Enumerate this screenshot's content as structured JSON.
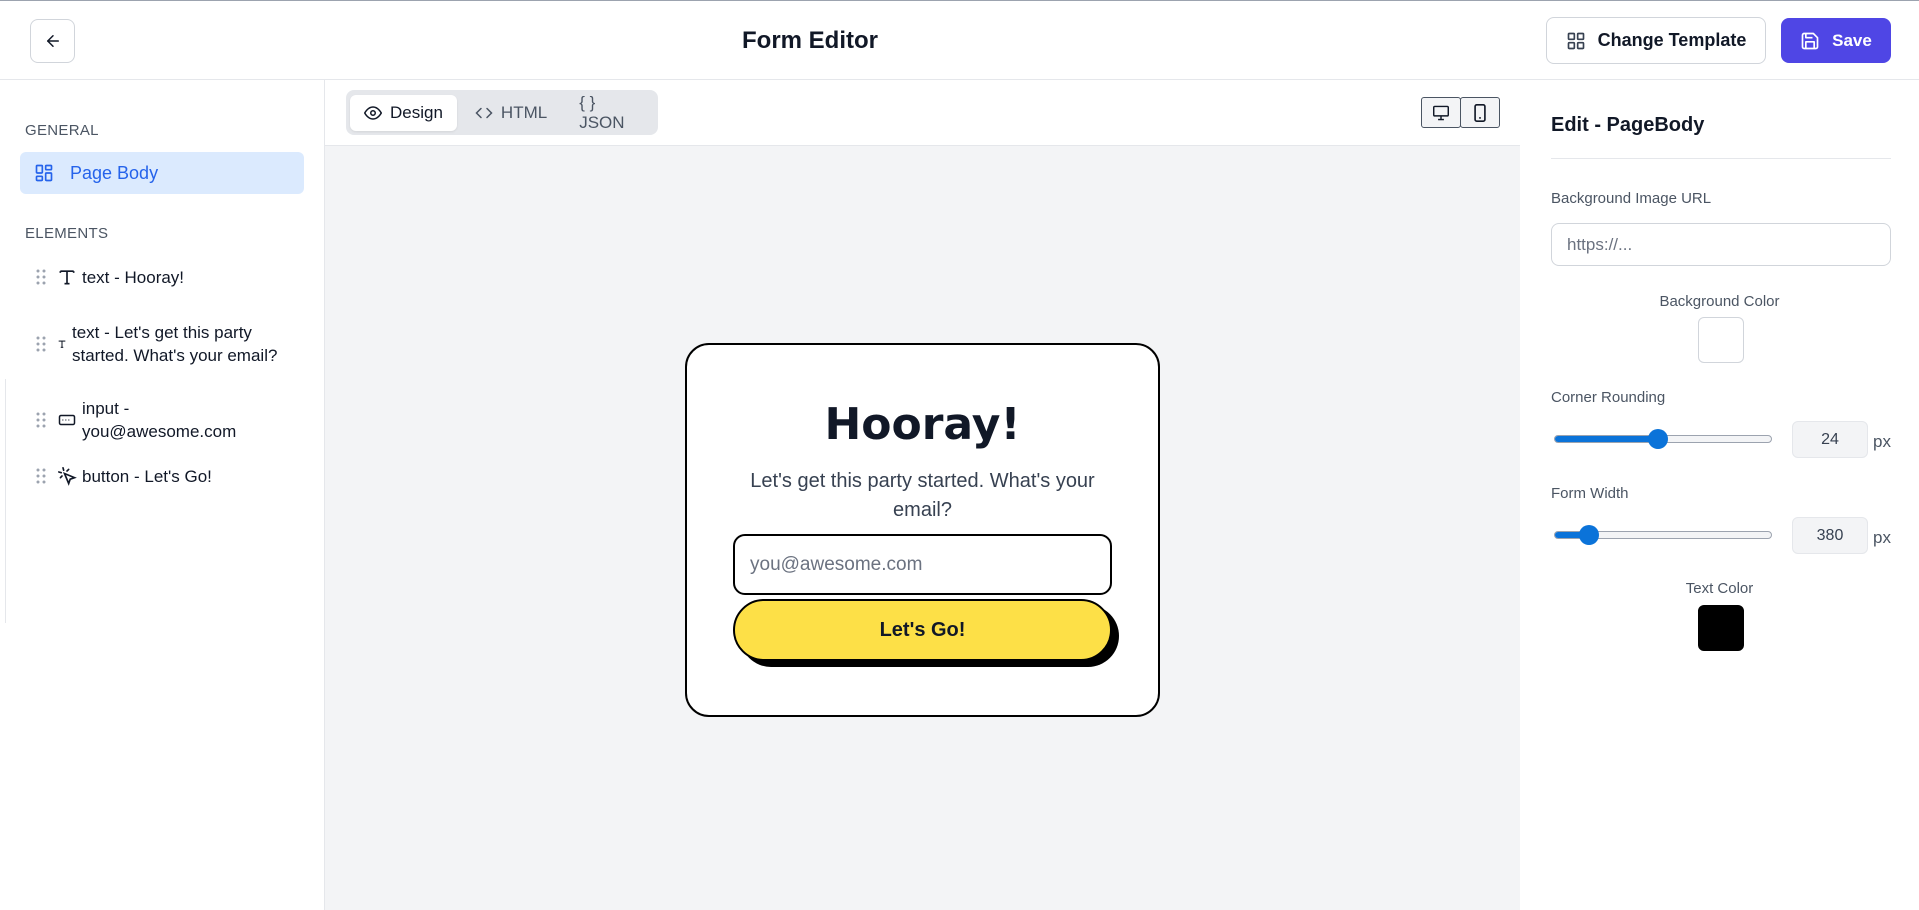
{
  "header": {
    "title": "Form Editor",
    "change_template_label": "Change Template",
    "save_label": "Save"
  },
  "sidebar": {
    "general_label": "GENERAL",
    "page_body_label": "Page Body",
    "elements_label": "ELEMENTS",
    "elements": [
      {
        "type": "text",
        "label": "text - Hooray!"
      },
      {
        "type": "text",
        "label": "text - Let's get this party started. What's your email?"
      },
      {
        "type": "input",
        "label": "input - you@awesome.com"
      },
      {
        "type": "button",
        "label": "button - Let's Go!"
      }
    ]
  },
  "canvas": {
    "tabs": [
      {
        "label": "Design",
        "icon": "eye-icon",
        "active": true
      },
      {
        "label": "HTML",
        "icon": "code-icon",
        "active": false
      },
      {
        "label": "{ } JSON",
        "icon": "",
        "active": false
      }
    ],
    "device_buttons": [
      "desktop-icon",
      "mobile-icon"
    ]
  },
  "form": {
    "title": "Hooray!",
    "subtitle": "Let's get this party started. What's your email?",
    "input_placeholder": "you@awesome.com",
    "button_label": "Let's Go!",
    "button_color": "#fde047"
  },
  "panel": {
    "title": "Edit - PageBody",
    "bg_image_label": "Background Image URL",
    "bg_image_placeholder": "https://...",
    "bg_color_label": "Background Color",
    "bg_color": "#ffffff",
    "corner_label": "Corner Rounding",
    "corner_value": "24",
    "corner_fraction": 0.47,
    "width_label": "Form Width",
    "width_value": "380",
    "width_fraction": 0.12,
    "unit": "px",
    "text_color_label": "Text Color",
    "text_color": "#000000"
  },
  "colors": {
    "accent": "#4f46e5",
    "selected_bg": "#dbeafe",
    "selected_text": "#2563eb",
    "slider": "#0b73d9"
  }
}
